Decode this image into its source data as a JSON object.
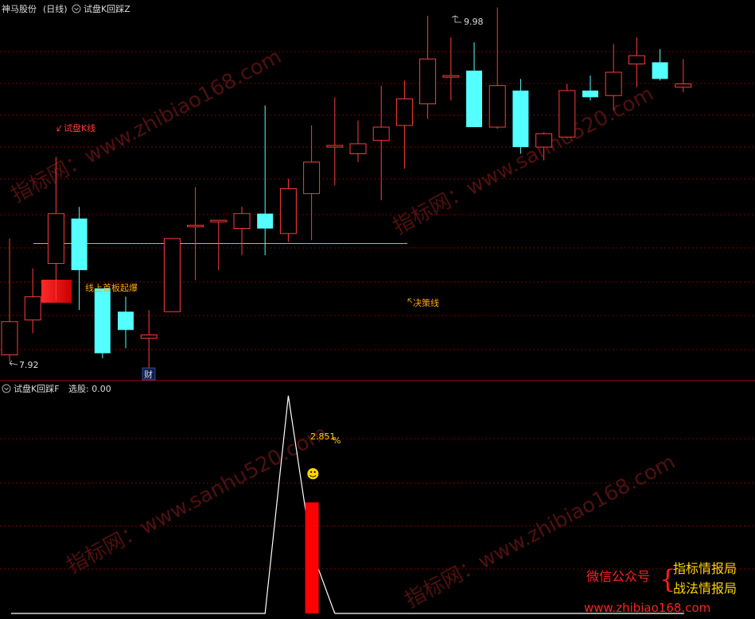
{
  "header": {
    "stock_name": "神马股份",
    "period": "(日线)",
    "indicator_name": "试盘K回踩Z"
  },
  "sub_header": {
    "indicator_name": "试盘K回踩F",
    "select_label": "选股: 0.00"
  },
  "annotations": {
    "high_label": "9.98",
    "low_label": "7.92",
    "trial_k_line": "试盘K线",
    "first_board": "线上首板起爆",
    "decision_line": "决策线",
    "cai_tag": "财",
    "percent_label": "2.851",
    "percent_sign": "%",
    "smiley": "☻"
  },
  "watermarks": {
    "w1": "指标网：www.zhibiao168.com",
    "w2": "指标网：www.sanhu520.com",
    "w3": "指标网：www.sanhu520.com",
    "w4": "指标网：www.zhibiao168.com"
  },
  "footer": {
    "wechat_label": "微信公众号",
    "brace": "{",
    "name1": "指标情报局",
    "name2": "战法情报局",
    "url": "www.zhibiao168.com"
  },
  "colors": {
    "up": "#ff3b3b",
    "down": "#54ffff",
    "decision": "#ffa800",
    "grid": "#7a0000",
    "separator": "#b00000",
    "header_text": "#dcdcdc",
    "wechat_red": "#ff2020",
    "name_yellow": "#ffd400"
  },
  "chart_data": {
    "type": "candlestick",
    "decision_level": 8.63,
    "candles": [
      {
        "o": 7.96,
        "h": 8.66,
        "l": 7.92,
        "c": 8.16
      },
      {
        "o": 8.17,
        "h": 8.48,
        "l": 8.09,
        "c": 8.31
      },
      {
        "o": 8.51,
        "h": 9.15,
        "l": 8.29,
        "c": 8.81
      },
      {
        "o": 8.78,
        "h": 8.85,
        "l": 8.23,
        "c": 8.47
      },
      {
        "o": 8.36,
        "h": 8.36,
        "l": 7.94,
        "c": 7.97
      },
      {
        "o": 8.22,
        "h": 8.31,
        "l": 8.0,
        "c": 8.11
      },
      {
        "o": 8.06,
        "h": 8.23,
        "l": 7.82,
        "c": 8.08
      },
      {
        "o": 8.22,
        "h": 8.66,
        "l": 8.22,
        "c": 8.66
      },
      {
        "o": 8.74,
        "h": 8.97,
        "l": 8.41,
        "c": 8.74
      },
      {
        "o": 8.77,
        "h": 8.77,
        "l": 8.47,
        "c": 8.77
      },
      {
        "o": 8.72,
        "h": 8.85,
        "l": 8.56,
        "c": 8.81
      },
      {
        "o": 8.81,
        "h": 9.46,
        "l": 8.56,
        "c": 8.72
      },
      {
        "o": 8.69,
        "h": 9.02,
        "l": 8.64,
        "c": 8.96
      },
      {
        "o": 8.93,
        "h": 9.34,
        "l": 8.65,
        "c": 9.12
      },
      {
        "o": 9.21,
        "h": 9.51,
        "l": 8.98,
        "c": 9.22
      },
      {
        "o": 9.17,
        "h": 9.37,
        "l": 9.12,
        "c": 9.23
      },
      {
        "o": 9.25,
        "h": 9.58,
        "l": 8.89,
        "c": 9.33
      },
      {
        "o": 9.34,
        "h": 9.61,
        "l": 9.08,
        "c": 9.5
      },
      {
        "o": 9.47,
        "h": 10.0,
        "l": 9.38,
        "c": 9.74
      },
      {
        "o": 9.64,
        "h": 9.87,
        "l": 9.49,
        "c": 9.64
      },
      {
        "o": 9.67,
        "h": 9.84,
        "l": 9.4,
        "c": 9.33
      },
      {
        "o": 9.33,
        "h": 10.05,
        "l": 9.32,
        "c": 9.58
      },
      {
        "o": 9.55,
        "h": 9.62,
        "l": 9.17,
        "c": 9.21
      },
      {
        "o": 9.21,
        "h": 9.3,
        "l": 9.13,
        "c": 9.29
      },
      {
        "o": 9.27,
        "h": 9.59,
        "l": 9.26,
        "c": 9.55
      },
      {
        "o": 9.55,
        "h": 9.64,
        "l": 9.49,
        "c": 9.51
      },
      {
        "o": 9.52,
        "h": 9.83,
        "l": 9.43,
        "c": 9.66
      },
      {
        "o": 9.71,
        "h": 9.87,
        "l": 9.57,
        "c": 9.76
      },
      {
        "o": 9.72,
        "h": 9.8,
        "l": 9.61,
        "c": 9.62
      },
      {
        "o": 9.57,
        "h": 9.74,
        "l": 9.54,
        "c": 9.59
      }
    ],
    "sub_line_x": [
      0,
      11,
      12,
      13,
      14
    ],
    "sub_line_y": [
      0,
      0,
      1.0,
      0.29,
      0
    ],
    "sub_bar": {
      "index": 13,
      "value": 0.51
    }
  }
}
